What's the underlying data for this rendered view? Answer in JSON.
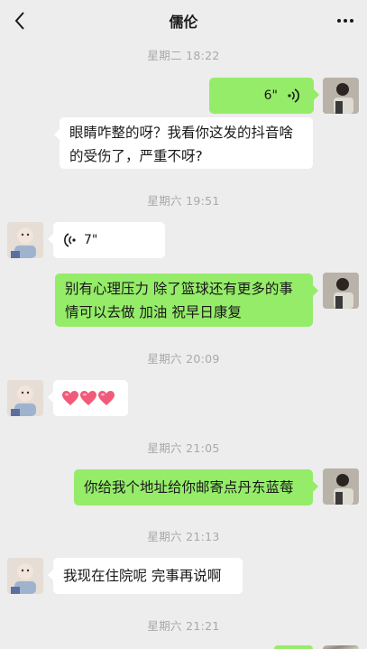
{
  "header": {
    "title": "儒伦"
  },
  "messages": {
    "ts1": "星期二 18:22",
    "voice_self_1": "6\"",
    "text_other_1": "眼睛咋整的呀？我看你这发的抖音啥的受伤了，严重不呀?",
    "ts2": "星期六 19:51",
    "voice_other_1": "7\"",
    "text_self_1": "别有心理压力 除了篮球还有更多的事情可以去做 加油 祝早日康复",
    "ts3": "星期六 20:09",
    "emoji_other_1": [
      "heart",
      "heart",
      "heart"
    ],
    "ts4": "星期六 21:05",
    "text_self_2": "你给我个地址给你邮寄点丹东蓝莓",
    "ts5": "星期六 21:13",
    "text_other_2": "我现在住院呢 完事再说啊",
    "ts6": "星期六 21:21"
  },
  "colors": {
    "background": "#ededed",
    "self_bubble": "#95ec69",
    "other_bubble": "#ffffff",
    "timestamp": "#a9a9a9",
    "heart": "#f25a7a"
  },
  "icons": {
    "back": "chevron-left-icon",
    "more": "more-dots-icon",
    "voice": "voice-wave-icon",
    "heart": "heart-emoji-icon"
  }
}
